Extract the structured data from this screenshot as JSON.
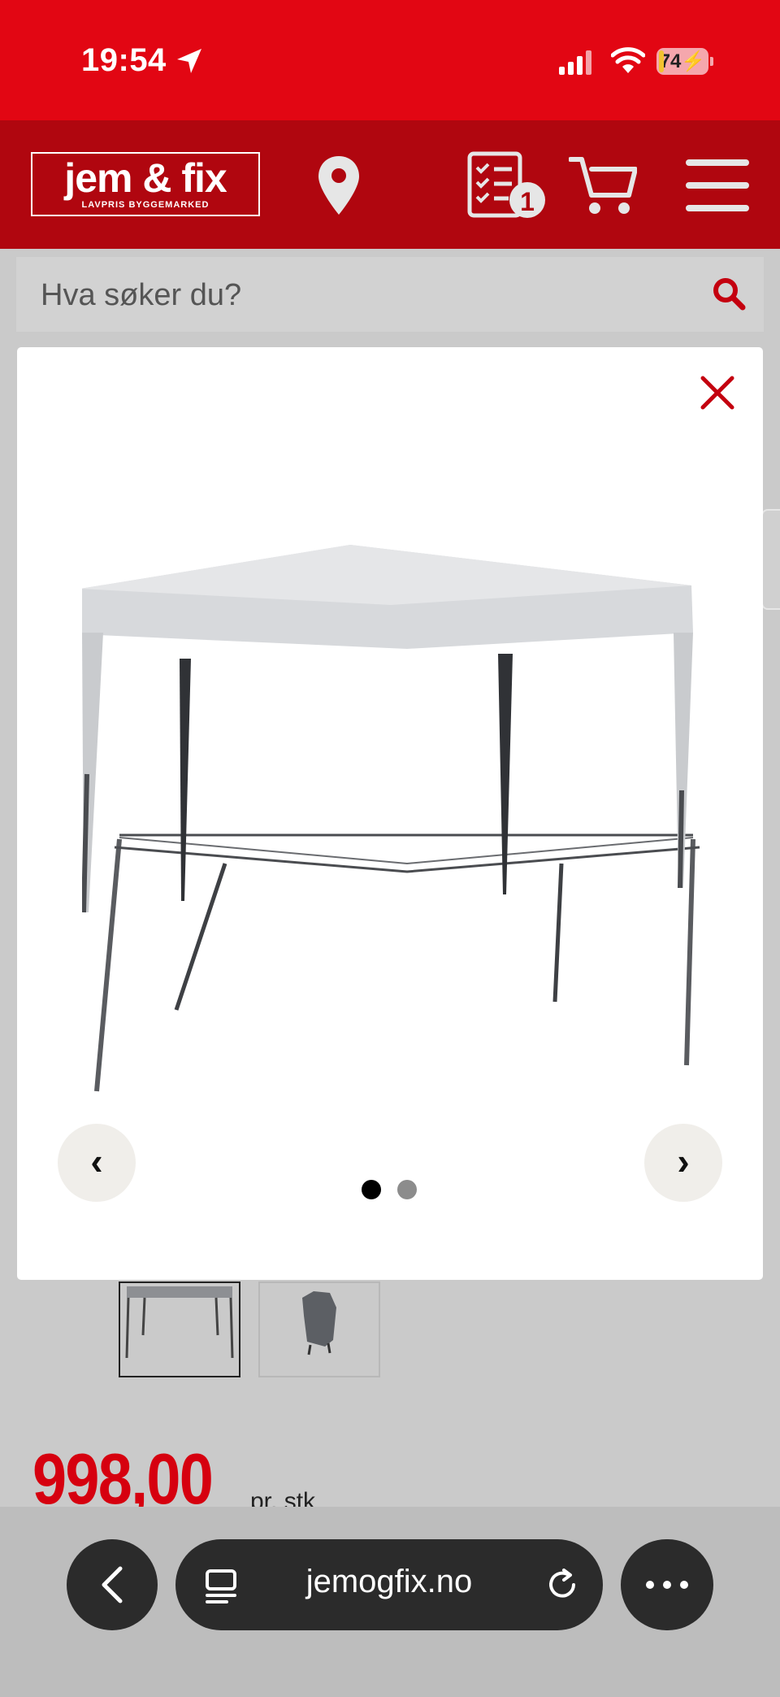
{
  "status_bar": {
    "time": "19:54",
    "battery": "74"
  },
  "header": {
    "logo_main": "jem & fix",
    "logo_sub": "LAVPRIS BYGGEMARKED",
    "shopping_list_count": "1",
    "colors": {
      "red": "#e20613",
      "dark_red": "#b0060f"
    }
  },
  "search": {
    "placeholder": "Hva søker du?"
  },
  "gallery": {
    "prev_glyph": "‹",
    "next_glyph": "›",
    "slides": 2,
    "active_slide": 1
  },
  "product": {
    "price": "998,00",
    "unit": "pr. stk"
  },
  "browser": {
    "url": "jemogfix.no"
  }
}
